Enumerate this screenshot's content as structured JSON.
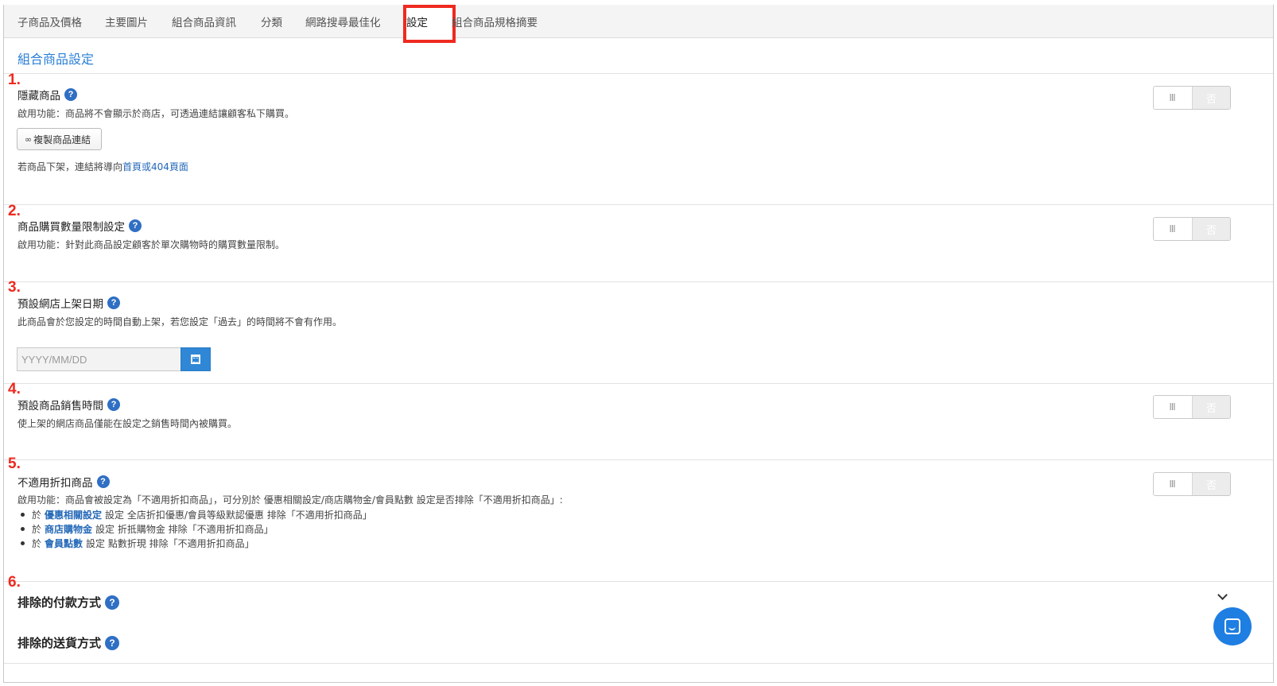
{
  "tabs": [
    {
      "label": "子商品及價格"
    },
    {
      "label": "主要圖片"
    },
    {
      "label": "組合商品資訊"
    },
    {
      "label": "分類"
    },
    {
      "label": "網路搜尋最佳化"
    },
    {
      "label": "設定"
    },
    {
      "label": "組合商品規格摘要"
    }
  ],
  "active_tab": "設定",
  "section_title": "組合商品設定",
  "help_glyph": "?",
  "settings": [
    {
      "number": "1.",
      "label": "隱藏商品",
      "description": "啟用功能：商品將不會顯示於商店，可透過連結讓顧客私下購買。",
      "copy_button": "複製商品連結",
      "note_prefix": "若商品下架，連結將導向",
      "note_link": "首頁或404頁面",
      "toggle": {
        "on_label": "Ⅲ",
        "off_label": "否",
        "value": "否"
      }
    },
    {
      "number": "2.",
      "label": "商品購買數量限制設定",
      "description": "啟用功能：針對此商品設定顧客於單次購物時的購買數量限制。",
      "toggle": {
        "on_label": "Ⅲ",
        "off_label": "否",
        "value": "否"
      }
    },
    {
      "number": "3.",
      "label": "預設網店上架日期",
      "description": "此商品會於您設定的時間自動上架，若您設定「過去」的時間將不會有作用。",
      "date_placeholder": "YYYY/MM/DD"
    },
    {
      "number": "4.",
      "label": "預設商品銷售時間",
      "description": "使上架的網店商品僅能在設定之銷售時間內被購買。",
      "toggle": {
        "on_label": "Ⅲ",
        "off_label": "否",
        "value": "否"
      }
    },
    {
      "number": "5.",
      "label": "不適用折扣商品",
      "description": "啟用功能：商品會被設定為「不適用折扣商品」，可分別於 優惠相關設定/商店購物金/會員點數 設定是否排除「不適用折扣商品」:",
      "bullets": [
        {
          "prefix": "於",
          "link": "優惠相關設定",
          "suffix": "設定 全店折扣優惠/會員等級默認優惠 排除「不適用折扣商品」"
        },
        {
          "prefix": "於",
          "link": "商店購物金",
          "suffix": "設定 折抵購物金 排除「不適用折扣商品」"
        },
        {
          "prefix": "於",
          "link": "會員點數",
          "suffix": "設定 點數折現 排除「不適用折扣商品」"
        }
      ],
      "toggle": {
        "on_label": "Ⅲ",
        "off_label": "否",
        "value": "否"
      }
    },
    {
      "number": "6.",
      "label": "排除的付款方式"
    }
  ],
  "shipping_label": "排除的送貨方式",
  "colors": {
    "accent": "#2a7fd4",
    "annotation_red": "#ee2a1f",
    "chat_blue": "#1f7ee2"
  }
}
